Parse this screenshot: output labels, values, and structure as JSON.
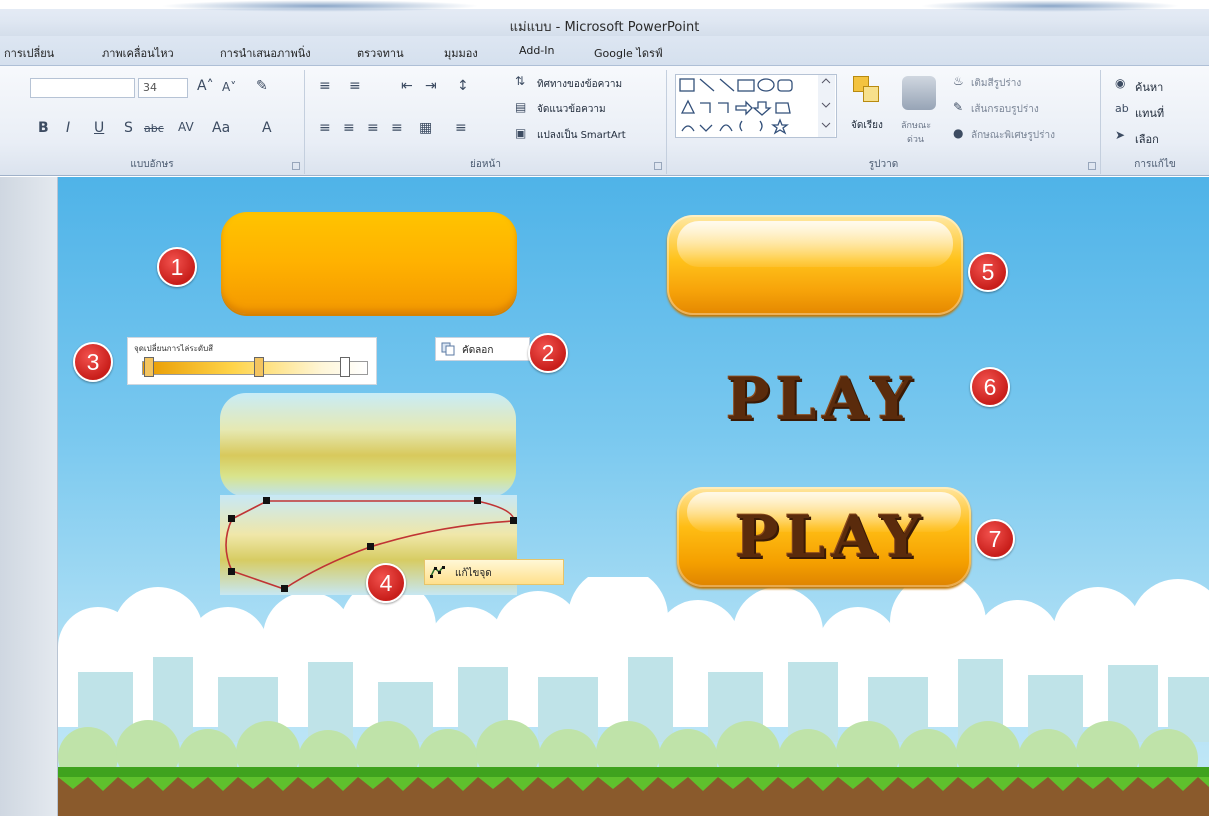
{
  "window": {
    "title": "แม่แบบ - Microsoft PowerPoint"
  },
  "tabs": [
    "การเปลี่ยน",
    "ภาพเคลื่อนไหว",
    "การนำเสนอภาพนิ่ง",
    "ตรวจทาน",
    "มุมมอง",
    "Add-In",
    "Google ไดรฟ์"
  ],
  "ribbon": {
    "font": {
      "label": "แบบอักษร",
      "size_value": "34"
    },
    "paragraph": {
      "label": "ย่อหน้า",
      "text_direction": "ทิศทางของข้อความ",
      "align_text": "จัดแนวข้อความ",
      "convert_smartart": "แปลงเป็น SmartArt"
    },
    "drawing": {
      "label": "รูปวาด",
      "arrange": "จัดเรียง",
      "quick_styles_line1": "ลักษณะ",
      "quick_styles_line2": "ด่วน",
      "shape_fill": "เติมสีรูปร่าง",
      "shape_outline": "เส้นกรอบรูปร่าง",
      "shape_effects": "ลักษณะพิเศษรูปร่าง"
    },
    "editing": {
      "label": "การแก้ไข",
      "find": "ค้นหา",
      "replace": "แทนที่",
      "select": "เลือก"
    }
  },
  "slide": {
    "gradient_panel_title": "จุดเปลี่ยนการไล่ระดับสี",
    "copy_tooltip": "คัดลอก",
    "edit_points_tooltip": "แก้ไขจุด",
    "play_text_6": "PLAY",
    "play_text_7": "PLAY",
    "badges": [
      "1",
      "2",
      "3",
      "4",
      "5",
      "6",
      "7"
    ]
  },
  "colors": {
    "accent_orange": "#ffb100",
    "badge_red": "#d42a25",
    "play_brown": "#5a2b0c",
    "sky_blue": "#4fb3e8"
  }
}
